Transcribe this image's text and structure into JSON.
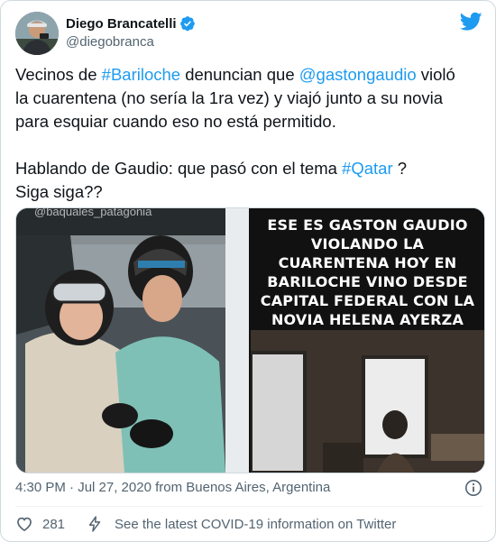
{
  "author": {
    "display_name": "Diego Brancatelli",
    "handle": "@diegobranca",
    "verified": true
  },
  "tweet": {
    "line1_pre": "Vecinos de ",
    "line1_hashtag": "#Bariloche",
    "line1_mid": " denuncian que ",
    "line1_mention": "@gastongaudio",
    "line1_post": " violó",
    "line2": "la cuarentena (no sería la 1ra vez) y viajó junto a su novia",
    "line3": "para esquiar cuando eso no está permitido.",
    "line4_pre": "Hablando de Gaudio: que pasó con el tema ",
    "line4_hashtag": "#Qatar",
    "line4_post": " ?",
    "line5": "Siga siga??"
  },
  "media": {
    "left_watermark": "@baquales_patagonia",
    "overlay_lines": [
      "ESE ES GASTON GAUDIO",
      "VIOLANDO LA",
      "CUARENTENA HOY EN",
      "BARILOCHE VINO DESDE",
      "CAPITAL FEDERAL CON LA",
      "NOVIA HELENA AYERZA"
    ]
  },
  "meta": {
    "timestamp": "4:30 PM · Jul 27, 2020 from Buenos Aires, Argentina"
  },
  "actions": {
    "like_count": "281",
    "covid_info": "See the latest COVID-19 information on Twitter"
  },
  "icons": {
    "verified": "verified-badge-icon",
    "logo": "twitter-bird-icon",
    "info": "info-icon",
    "like": "heart-icon",
    "covid": "lightning-bolt-icon"
  },
  "colors": {
    "link": "#1d9bf0",
    "text": "#0f1419",
    "secondary": "#536471",
    "border": "#cfd9de"
  }
}
